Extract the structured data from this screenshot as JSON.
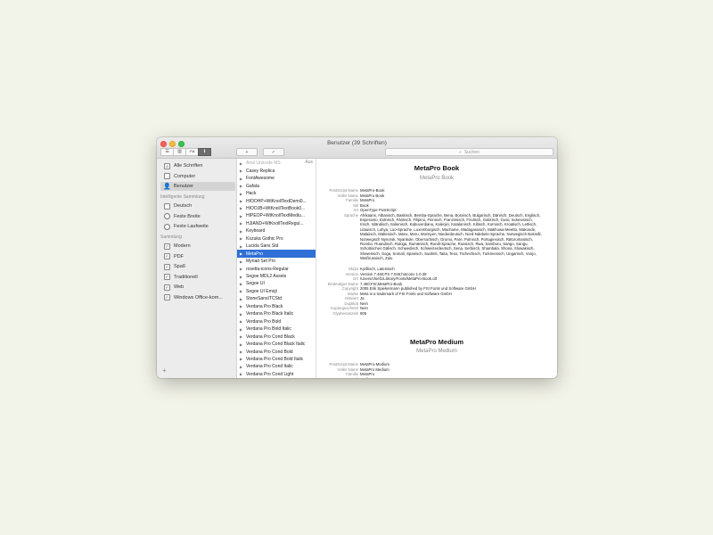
{
  "window": {
    "title": "Benutzer (39 Schriften)"
  },
  "toolbar": {
    "seg_list": "☰",
    "seg_grid": "▥",
    "seg_sample": "Aa",
    "seg_info": "ℹ",
    "add": "+",
    "validate": "✓",
    "search_placeholder": "Suchen"
  },
  "sidebar": {
    "items": [
      {
        "label": "Alle Schriften",
        "icon": "font-collection-icon"
      },
      {
        "label": "Computer",
        "icon": "computer-icon"
      },
      {
        "label": "Benutzer",
        "icon": "user-icon"
      }
    ],
    "smart_heading": "Intelligente Sammlung",
    "smart_items": [
      {
        "label": "Deutsch"
      },
      {
        "label": "Feste Breite"
      },
      {
        "label": "Feste Laufweite"
      }
    ],
    "collection_heading": "Sammlung",
    "collections": [
      {
        "label": "Modern"
      },
      {
        "label": "PDF"
      },
      {
        "label": "Spaß"
      },
      {
        "label": "Traditionell"
      },
      {
        "label": "Web"
      },
      {
        "label": "Windows Office-kom..."
      }
    ],
    "add": "+"
  },
  "fonts": {
    "status": "Aus",
    "items": [
      {
        "label": "Arial Unicode MS",
        "dim": true
      },
      {
        "label": "Casey Replica"
      },
      {
        "label": "FontAwesome"
      },
      {
        "label": "Gafata"
      },
      {
        "label": "Hack"
      },
      {
        "label": "HIOOHP+WtKnollTextDemi0..."
      },
      {
        "label": "HIOOJB+WtKnollTextBook0..."
      },
      {
        "label": "HIPEOP+WtKnollTextMediu..."
      },
      {
        "label": "HJIAND+WtKnollTextRegul..."
      },
      {
        "label": "Keyboard"
      },
      {
        "label": "Kozuka Gothic Pro"
      },
      {
        "label": "Lucida Sans Std"
      },
      {
        "label": "MetaPro",
        "selected": true
      },
      {
        "label": "Myriad Set Pro"
      },
      {
        "label": "rosetta-icons-Regular"
      },
      {
        "label": "Segoe MDL2 Assets"
      },
      {
        "label": "Segoe UI"
      },
      {
        "label": "Segoe UI Emoji"
      },
      {
        "label": "StoneSansITCStd"
      },
      {
        "label": "Verdana Pro Black"
      },
      {
        "label": "Verdana Pro Black Italic"
      },
      {
        "label": "Verdana Pro Bold"
      },
      {
        "label": "Verdana Pro Bold Italic"
      },
      {
        "label": "Verdana Pro Cond Black"
      },
      {
        "label": "Verdana Pro Cond Black Italic"
      },
      {
        "label": "Verdana Pro Cond Bold"
      },
      {
        "label": "Verdana Pro Cond Bold Italic"
      },
      {
        "label": "Verdana Pro Cond Italic"
      },
      {
        "label": "Verdana Pro Cond Light"
      }
    ]
  },
  "detail": {
    "book": {
      "title": "MetaPro Book",
      "subtitle": "MetaPro Book",
      "rows": [
        {
          "k": "PostScript-Name",
          "v": "MetaPro-Book"
        },
        {
          "k": "Voller Name",
          "v": "MetaPro Book"
        },
        {
          "k": "Familie",
          "v": "MetaPro"
        },
        {
          "k": "Stil",
          "v": "Book"
        },
        {
          "k": "Art",
          "v": "OpenType PostScript"
        },
        {
          "k": "Sprache",
          "v": "Afrikaans, Albanisch, Baskisch, Bemba-Sprache, Bena, Bosnisch, Bulgarisch, Dänisch, Deutsch, Englisch, Esperanto, Estnisch, Färöisch, Filipino, Finnisch, Französisch, Friulisch, Galizisch, Gusii, Indonesisch, Irisch, Isländisch, Italienisch, Kabuverdianu, Kalenjin, Katalanisch, Kiltisch, Kornisch, Kroatisch, Lettisch, Litauisch, Luhya, Luo-Sprache, Luxemburgisch, Machame, Madagassisch, Makhuwa-Meetto, Makonde, Malaiisch, Maltesisch, Manx, Meru, Morisyen, Niederdeutsch, Nord-Ndebele-Sprache, Norwegisch Bokmål, Norwegisch Nynorsk, Nyankole, Obersorbisch, Oromo, Pare, Polnisch, Portugiesisch, Rätoromanisch, Rombo, Ruandisch, Rukiga, Rumänisch, Rundi-Sprache, Russisch, Rwa, Samburu, Sango, Sangu, Schottisches Gälisch, Schwedisch, Schweizerdeutsch, Sena, Serbisch, Shambala, Shona, Slowakisch, Slowenisch, Soga, Somali, Spanisch, Suaheli, Taita, Teso, Tschechisch, Turkmenisch, Ungarisch, Vunjo, Weißrussisch, Zulu"
        },
        {
          "k": "Skript",
          "v": "Kyrillisch, Lateinisch"
        },
        {
          "k": "Version",
          "v": "Version 7.460;PS 7.046;hotconv 1.0.38"
        },
        {
          "k": "Ort",
          "v": "/Users/chief1/Library/Fonts/MetaPro-Book.otf"
        },
        {
          "k": "Eindeutiger Name",
          "v": "7.460;FSI;MetaPro-Book"
        },
        {
          "k": "Copyright",
          "v": "2005 Erik Spiekermann published by FSI Fonts und Software GmbH"
        },
        {
          "k": "Marke",
          "v": "Meta is a trademark of FSI Fonts und Software GmbH"
        },
        {
          "k": "Aktiviert",
          "v": "Ja"
        },
        {
          "k": "Duplikat",
          "v": "Nein"
        },
        {
          "k": "Kopiergeschützt",
          "v": "Nein"
        },
        {
          "k": "Glyphenanzahl",
          "v": "905"
        }
      ]
    },
    "medium": {
      "title": "MetaPro Medium",
      "subtitle": "MetaPro Medium",
      "rows": [
        {
          "k": "PostScript-Name",
          "v": "MetaPro-Medium"
        },
        {
          "k": "Voller Name",
          "v": "MetaPro Medium"
        },
        {
          "k": "Familie",
          "v": "MetaPro"
        },
        {
          "k": "Stil",
          "v": "Medium"
        }
      ]
    }
  }
}
